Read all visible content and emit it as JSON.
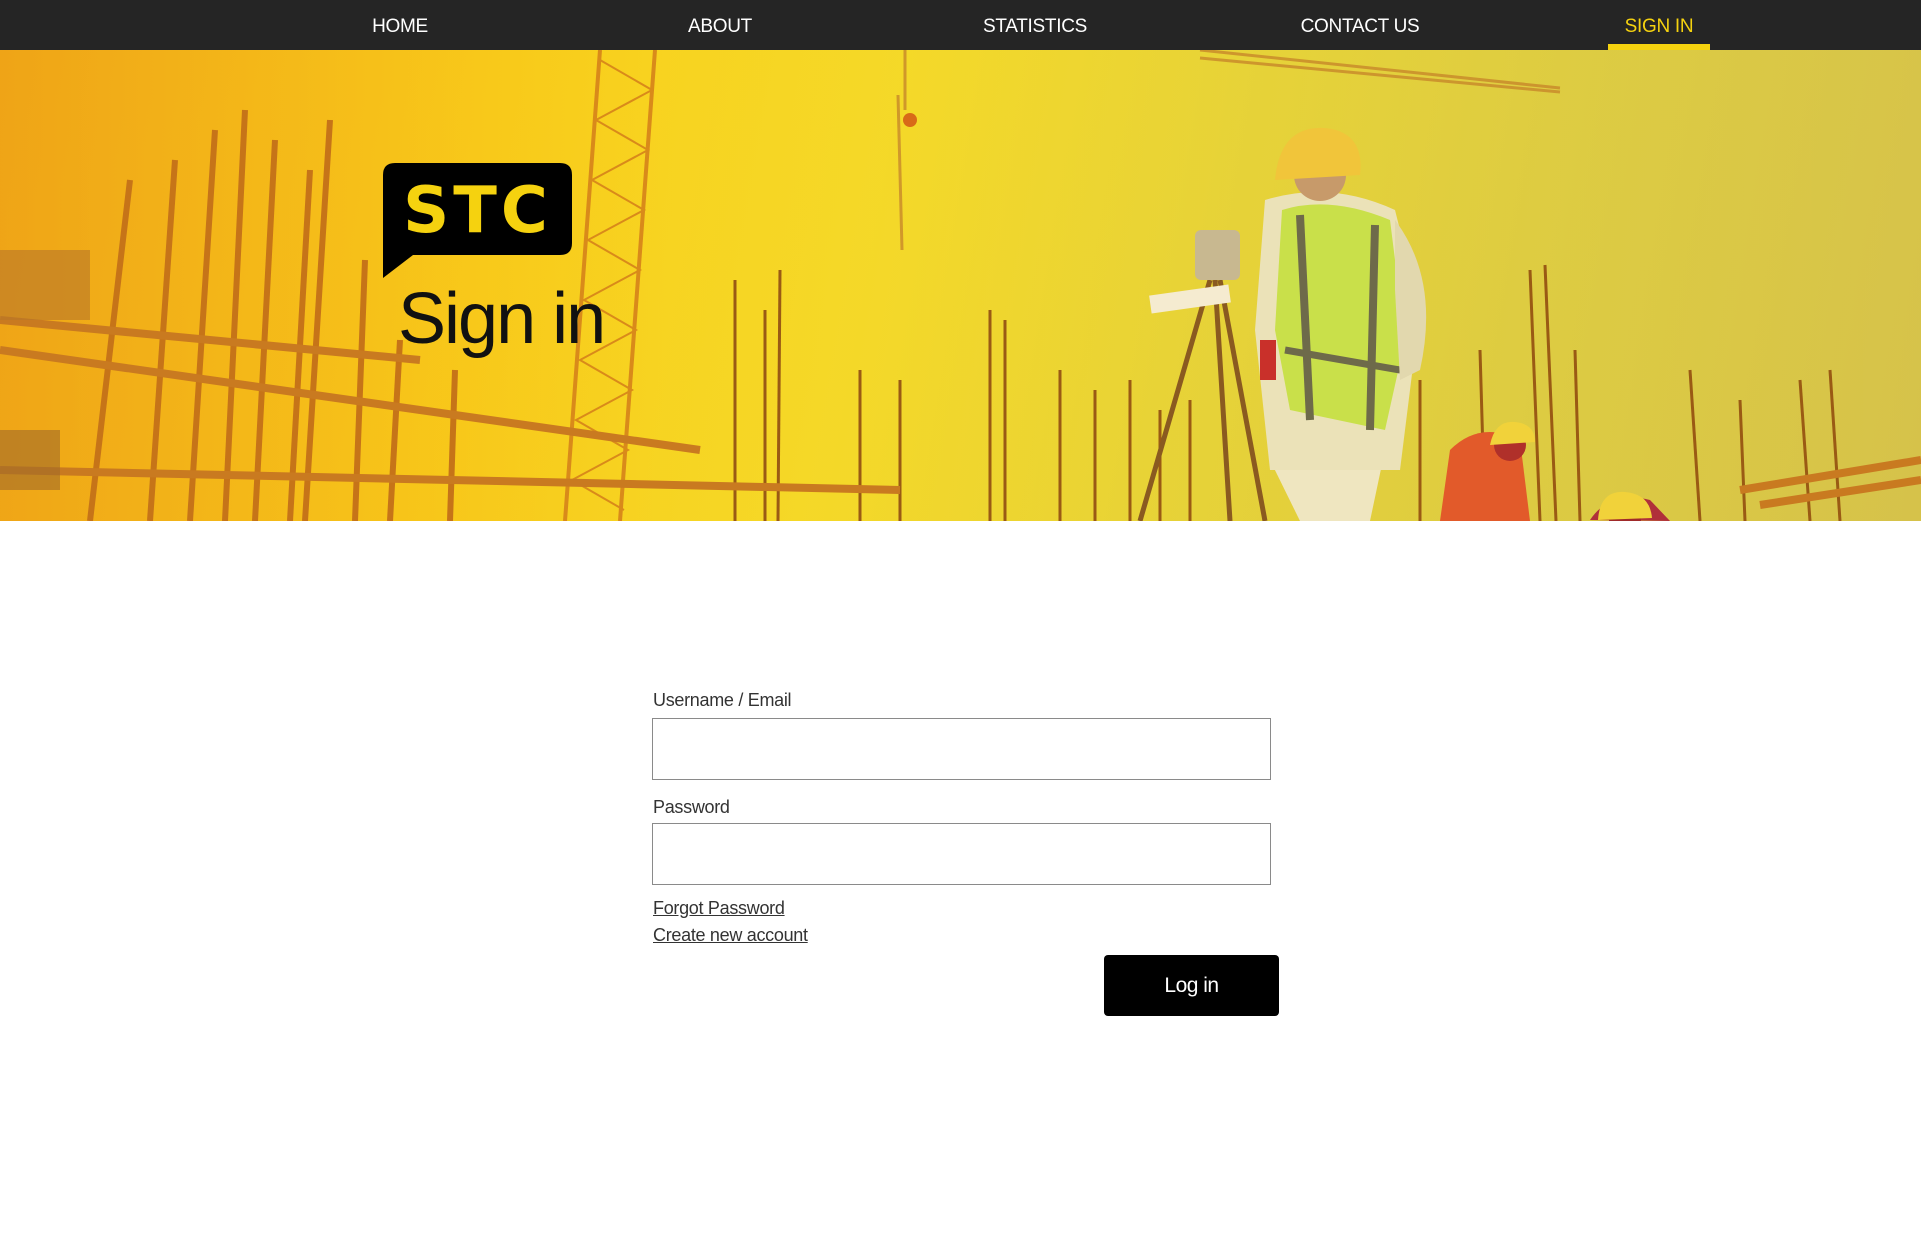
{
  "nav": {
    "items": [
      {
        "label": "HOME"
      },
      {
        "label": "ABOUT"
      },
      {
        "label": "STATISTICS"
      },
      {
        "label": "CONTACT US"
      },
      {
        "label": "SIGN IN"
      }
    ],
    "active": "SIGN IN"
  },
  "hero": {
    "logo_text": "STC",
    "title": "Sign in"
  },
  "form": {
    "username_label": "Username / Email",
    "username_value": "",
    "password_label": "Password",
    "password_value": "",
    "forgot_link": "Forgot Password",
    "create_link": "Create new account",
    "login_button": "Log in"
  },
  "colors": {
    "accent": "#f5d20f",
    "nav_bg": "#252525",
    "button_bg": "#000000"
  }
}
